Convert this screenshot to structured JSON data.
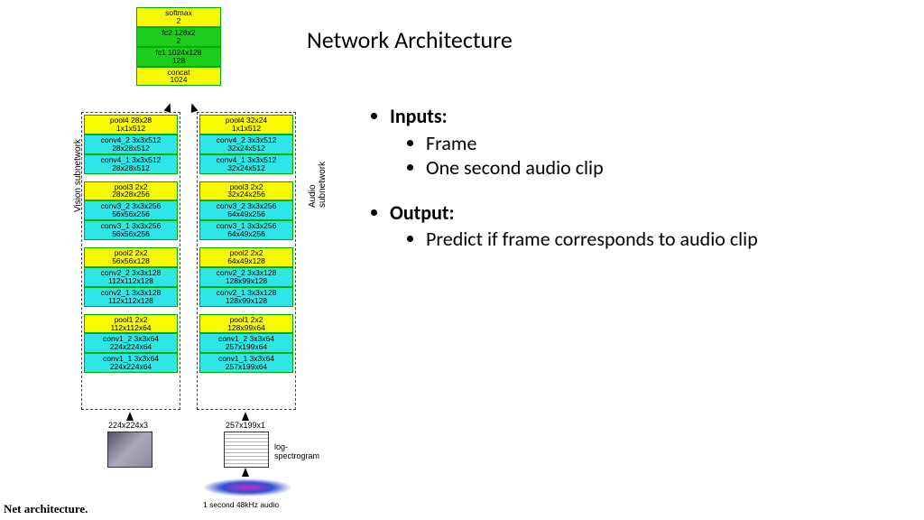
{
  "title": "Network Architecture",
  "bullets": {
    "inputs_label": "Inputs:",
    "inputs": [
      "Frame",
      "One second audio clip"
    ],
    "output_label": "Output:",
    "outputs": [
      "Predict if frame corresponds to audio clip"
    ]
  },
  "top_stack": [
    {
      "text": "softmax\n2",
      "cls": "yellow"
    },
    {
      "text": "fc2 128x2\n2",
      "cls": "green"
    },
    {
      "text": "fc1 1024x128\n128",
      "cls": "green"
    },
    {
      "text": "concat\n1024",
      "cls": "yellow"
    }
  ],
  "vision": {
    "label": "Vision subnetwork",
    "groups": [
      [
        {
          "text": "pool4 28x28\n1x1x512",
          "cls": "yellow"
        },
        {
          "text": "conv4_2 3x3x512\n28x28x512",
          "cls": "cyan"
        },
        {
          "text": "conv4_1 3x3x512\n28x28x512",
          "cls": "cyan"
        }
      ],
      [
        {
          "text": "pool3 2x2\n28x28x256",
          "cls": "yellow"
        },
        {
          "text": "conv3_2 3x3x256\n56x56x256",
          "cls": "cyan"
        },
        {
          "text": "conv3_1 3x3x256\n56x56x256",
          "cls": "cyan"
        }
      ],
      [
        {
          "text": "pool2 2x2\n56x56x128",
          "cls": "yellow"
        },
        {
          "text": "conv2_2 3x3x128\n112x112x128",
          "cls": "cyan"
        },
        {
          "text": "conv2_1 3x3x128\n112x112x128",
          "cls": "cyan"
        }
      ],
      [
        {
          "text": "pool1 2x2\n112x112x64",
          "cls": "yellow"
        },
        {
          "text": "conv1_2 3x3x64\n224x224x64",
          "cls": "cyan"
        },
        {
          "text": "conv1_1 3x3x64\n224x224x64",
          "cls": "cyan"
        }
      ]
    ],
    "input_dim": "224x224x3"
  },
  "audio": {
    "label": "Audio subnetwork",
    "groups": [
      [
        {
          "text": "pool4 32x24\n1x1x512",
          "cls": "yellow"
        },
        {
          "text": "conv4_2 3x3x512\n32x24x512",
          "cls": "cyan"
        },
        {
          "text": "conv4_1 3x3x512\n32x24x512",
          "cls": "cyan"
        }
      ],
      [
        {
          "text": "pool3 2x2\n32x24x256",
          "cls": "yellow"
        },
        {
          "text": "conv3_2 3x3x256\n64x49x256",
          "cls": "cyan"
        },
        {
          "text": "conv3_1 3x3x256\n64x49x256",
          "cls": "cyan"
        }
      ],
      [
        {
          "text": "pool2 2x2\n64x49x128",
          "cls": "yellow"
        },
        {
          "text": "conv2_2 3x3x128\n128x99x128",
          "cls": "cyan"
        },
        {
          "text": "conv2_1 3x3x128\n128x99x128",
          "cls": "cyan"
        }
      ],
      [
        {
          "text": "pool1 2x2\n128x99x64",
          "cls": "yellow"
        },
        {
          "text": "conv1_2 3x3x64\n257x199x64",
          "cls": "cyan"
        },
        {
          "text": "conv1_1 3x3x64\n257x199x64",
          "cls": "cyan"
        }
      ]
    ],
    "input_dim": "257x199x1"
  },
  "spectrogram_label": "log-spectrogram",
  "waveform_label": "1 second 48kHz audio",
  "caption": "Net architecture."
}
